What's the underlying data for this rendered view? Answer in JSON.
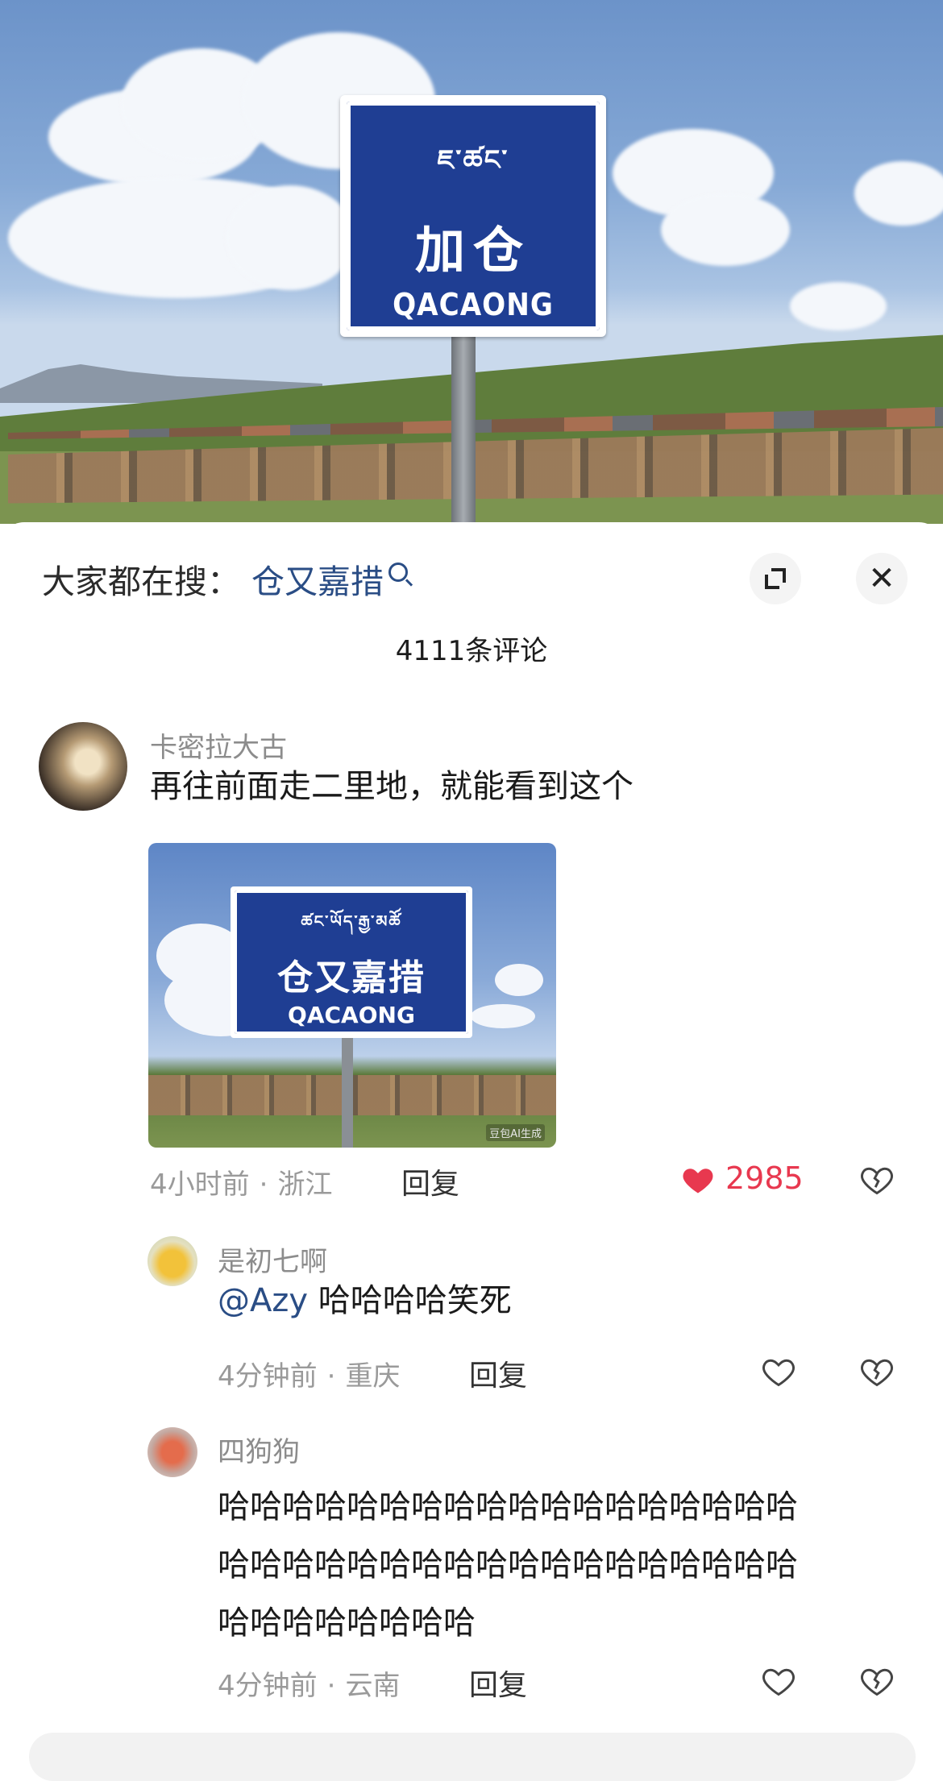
{
  "photo": {
    "sign_tibetan": "ཇ་ཚང་",
    "sign_chinese": "加仓",
    "sign_english": "QACAONG"
  },
  "search": {
    "label": "大家都在搜：",
    "term": "仓又嘉措"
  },
  "comments_count": "4111条评论",
  "comments": [
    {
      "username": "卡密拉大古",
      "text": "再往前面走二里地，就能看到这个",
      "image": {
        "sign_tibetan": "ཚང་ཡོད་རྒྱ་མཚོ",
        "sign_chinese": "仓又嘉措",
        "sign_english": "QACAONG",
        "watermark": "豆包AI生成"
      },
      "time": "4小时前",
      "location": "浙江",
      "reply_label": "回复",
      "likes": "2985"
    },
    {
      "username": "是初七啊",
      "mention": "@Azy",
      "text": " 哈哈哈哈笑死",
      "time": "4分钟前",
      "location": "重庆",
      "reply_label": "回复"
    },
    {
      "username": "四狗狗",
      "text_lines": [
        "哈哈哈哈哈哈哈哈哈哈哈哈哈哈哈哈哈哈",
        "哈哈哈哈哈哈哈哈哈哈哈哈哈哈哈哈哈哈",
        "哈哈哈哈哈哈哈哈"
      ],
      "time": "4分钟前",
      "location": "云南",
      "reply_label": "回复"
    }
  ],
  "meta_separator": "·",
  "colors": {
    "accent_blue": "#2a4d85",
    "like_red": "#e8384f"
  }
}
